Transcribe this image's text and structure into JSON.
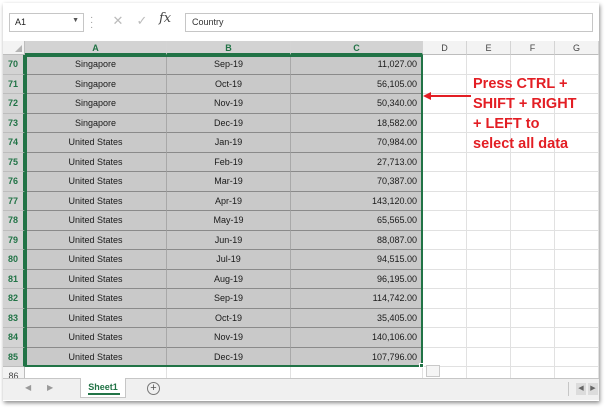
{
  "namebox": {
    "value": "A1"
  },
  "formula_bar": {
    "fx": "fx",
    "value": "Country"
  },
  "columns": [
    "A",
    "B",
    "C",
    "D",
    "E",
    "F",
    "G"
  ],
  "rows": [
    {
      "num": "70",
      "country": "Singapore",
      "month": "Sep-19",
      "value": "11,027.00"
    },
    {
      "num": "71",
      "country": "Singapore",
      "month": "Oct-19",
      "value": "56,105.00"
    },
    {
      "num": "72",
      "country": "Singapore",
      "month": "Nov-19",
      "value": "50,340.00"
    },
    {
      "num": "73",
      "country": "Singapore",
      "month": "Dec-19",
      "value": "18,582.00"
    },
    {
      "num": "74",
      "country": "United States",
      "month": "Jan-19",
      "value": "70,984.00"
    },
    {
      "num": "75",
      "country": "United States",
      "month": "Feb-19",
      "value": "27,713.00"
    },
    {
      "num": "76",
      "country": "United States",
      "month": "Mar-19",
      "value": "70,387.00"
    },
    {
      "num": "77",
      "country": "United States",
      "month": "Apr-19",
      "value": "143,120.00"
    },
    {
      "num": "78",
      "country": "United States",
      "month": "May-19",
      "value": "65,565.00"
    },
    {
      "num": "79",
      "country": "United States",
      "month": "Jun-19",
      "value": "88,087.00"
    },
    {
      "num": "80",
      "country": "United States",
      "month": "Jul-19",
      "value": "94,515.00"
    },
    {
      "num": "81",
      "country": "United States",
      "month": "Aug-19",
      "value": "96,195.00"
    },
    {
      "num": "82",
      "country": "United States",
      "month": "Sep-19",
      "value": "114,742.00"
    },
    {
      "num": "83",
      "country": "United States",
      "month": "Oct-19",
      "value": "35,405.00"
    },
    {
      "num": "84",
      "country": "United States",
      "month": "Nov-19",
      "value": "140,106.00"
    },
    {
      "num": "85",
      "country": "United States",
      "month": "Dec-19",
      "value": "107,796.00"
    }
  ],
  "empty_row": "86",
  "annotation": {
    "lines": [
      "Press CTRL +",
      "SHIFT + RIGHT",
      "+ LEFT to",
      "select all data"
    ],
    "color": "#e31e24"
  },
  "sheet_tabs": {
    "active": "Sheet1"
  },
  "colors": {
    "accent": "#217346",
    "selection": "#c9c9c9"
  }
}
